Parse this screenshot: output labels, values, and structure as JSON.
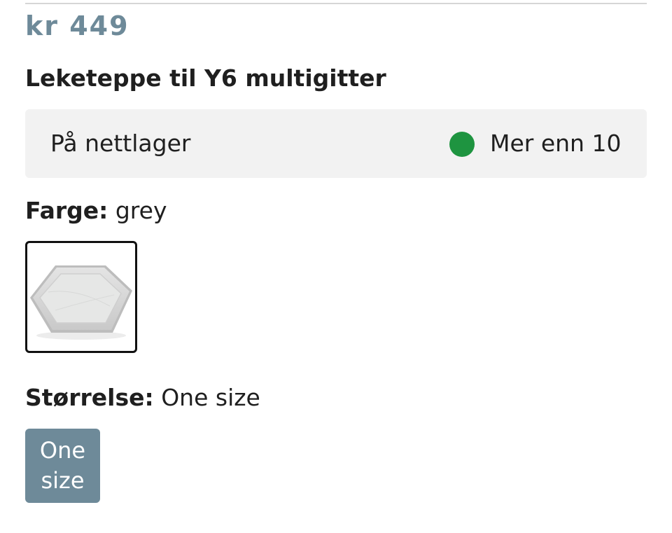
{
  "product": {
    "price": "kr 449",
    "title": "Leketeppe til Y6 multigitter"
  },
  "stock": {
    "label": "På nettlager",
    "value": "Mer enn 10",
    "status_color": "#1e9440"
  },
  "color_option": {
    "label": "Farge:",
    "selected": "grey",
    "swatches": [
      {
        "name": "grey",
        "icon": "hexagon-play-mat-image",
        "selected": true
      }
    ]
  },
  "size_option": {
    "label": "Størrelse:",
    "selected": "One size",
    "buttons": [
      {
        "label_line1": "One",
        "label_line2": "size",
        "selected": true
      }
    ]
  },
  "colors": {
    "accent": "#6e8a99",
    "stock_bg": "#f2f2f2"
  }
}
